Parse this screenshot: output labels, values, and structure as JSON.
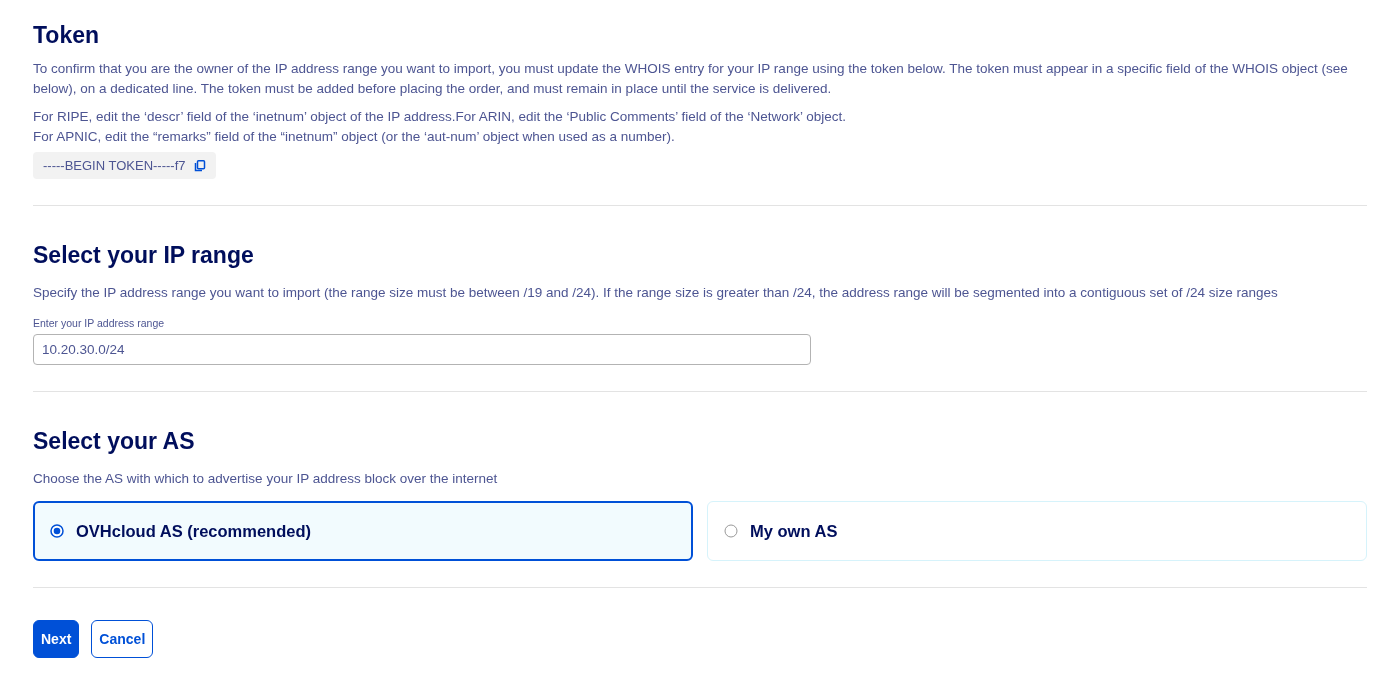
{
  "token_section": {
    "title": "Token",
    "paragraphs": [
      "To confirm that you are the owner of the IP address range you want to import, you must update the WHOIS entry for your IP range using the token below. The token must appear in a specific field of the WHOIS object (see below), on a dedicated line. The token must be added before placing the order, and must remain in place until the service is delivered."
    ],
    "instructions": [
      "For RIPE, edit the ‘descr’ field of the ‘inetnum’ object of the IP address.For ARIN, edit the ‘Public Comments’ field of the ‘Network’ object.",
      "For APNIC, edit the “remarks” field of the “inetnum” object (or the ‘aut-num’ object when used as a number)."
    ],
    "token": "-----BEGIN TOKEN-----f7"
  },
  "ip_section": {
    "title": "Select your IP range",
    "description": "Specify the IP address range you want to import (the range size must be between /19 and /24). If the range size is greater than /24, the address range will be segmented into a contiguous set of /24 size ranges",
    "field": {
      "label": "Enter your IP address range",
      "value": "10.20.30.0/24"
    }
  },
  "as_section": {
    "title": "Select your AS",
    "description": "Choose the AS with which to advertise your IP address block over the internet",
    "options": [
      {
        "label": "OVHcloud AS (recommended)",
        "selected": true
      },
      {
        "label": "My own AS",
        "selected": false
      }
    ]
  },
  "buttons": [
    {
      "label": "Next",
      "kind": "primary"
    },
    {
      "label": "Cancel",
      "kind": "secondary"
    }
  ]
}
